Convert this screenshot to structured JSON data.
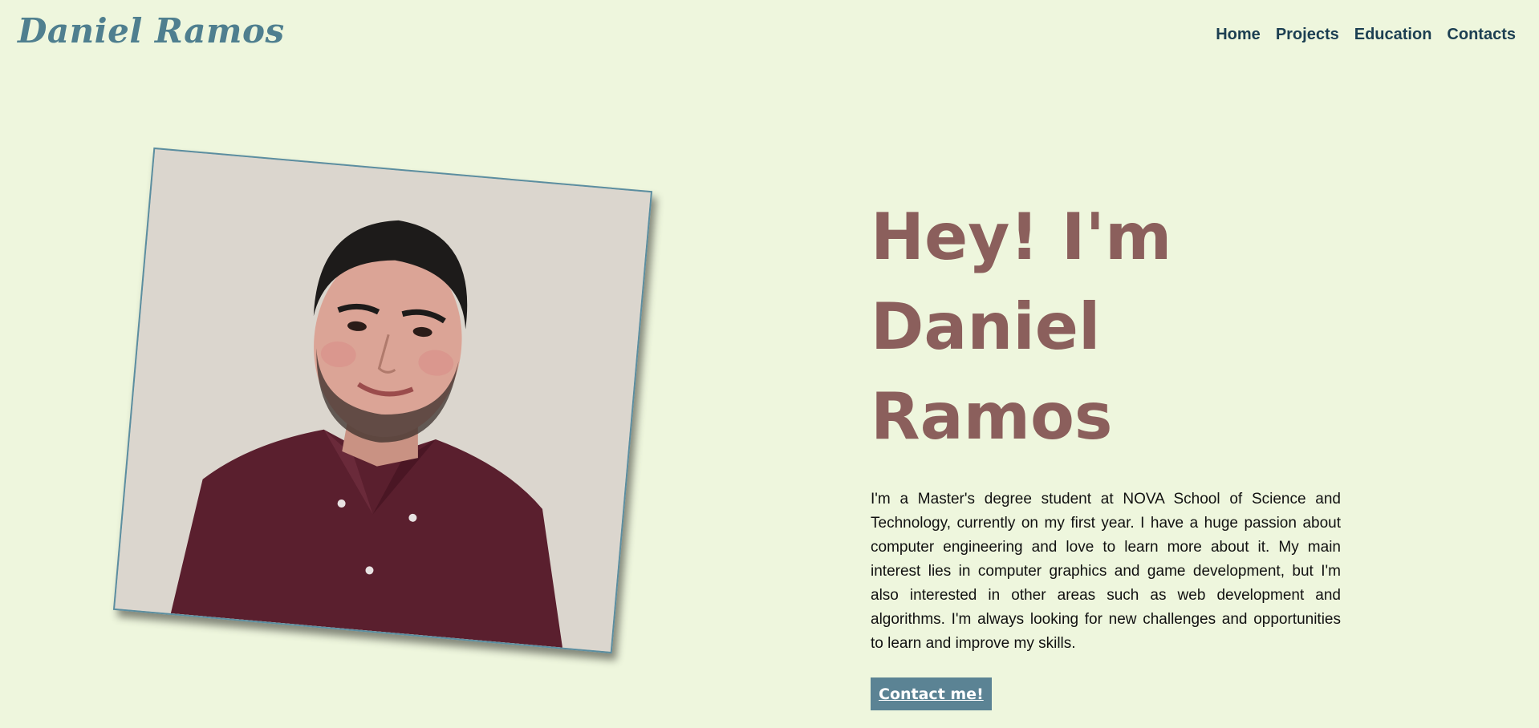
{
  "header": {
    "brand": "Daniel Ramos",
    "nav": [
      "Home",
      "Projects",
      "Education",
      "Contacts"
    ]
  },
  "hero": {
    "title_line1": "Hey! I'm",
    "title_line2": "Daniel Ramos",
    "bio": "I'm a Master's degree student at NOVA School of Science and Technology, currently on my first year. I have a huge passion about computer engineering and love to learn more about it. My main interest lies in computer graphics and game development, but I'm also interested in other areas such as web development and algorithms. I'm always looking for new challenges and opportunities to learn and improve my skills.",
    "cta_label": "Contact me!"
  },
  "colors": {
    "background": "#eef6dd",
    "brand": "#4f7f8f",
    "nav_text": "#1c3f52",
    "heading": "#8b5f5c",
    "button": "#5b8394"
  }
}
